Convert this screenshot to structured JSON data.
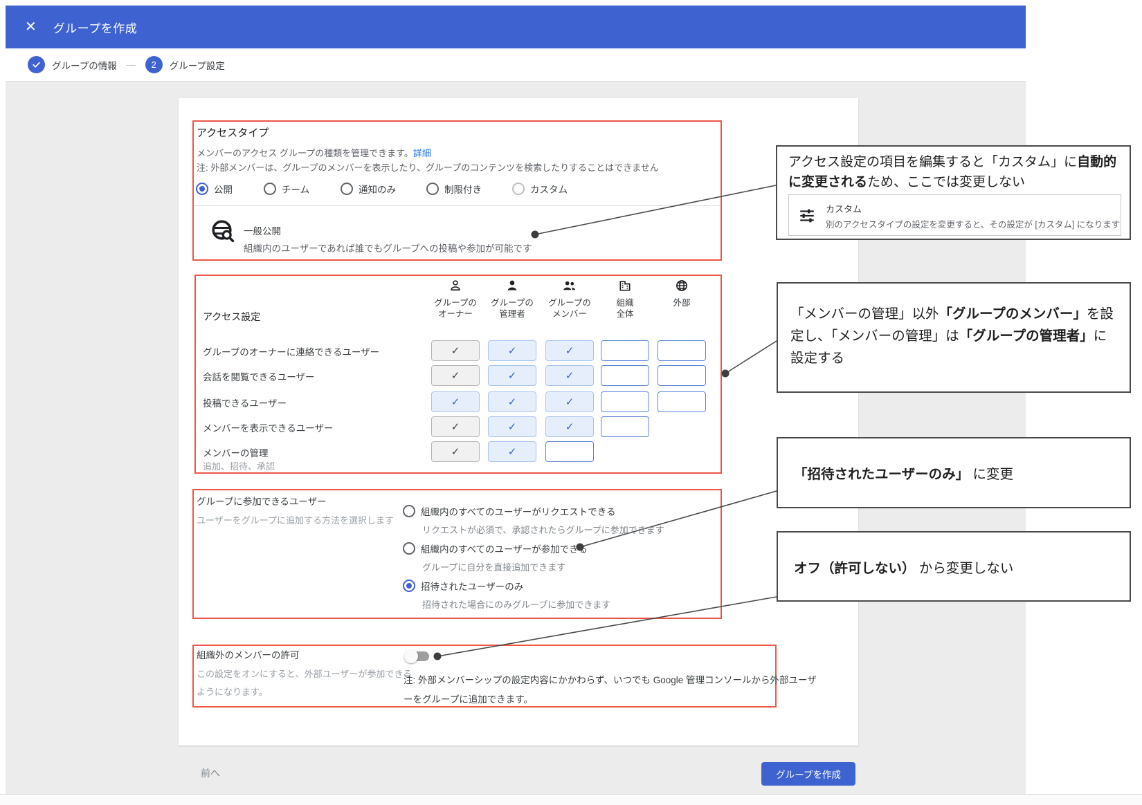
{
  "header": {
    "title": "グループを作成",
    "close_icon": "✕"
  },
  "stepper": {
    "separator": "—",
    "steps": [
      {
        "state": "done",
        "label": "グループの情報"
      },
      {
        "state": "active",
        "number": "2",
        "label": "グループ設定"
      }
    ]
  },
  "access_type": {
    "title": "アクセスタイプ",
    "description": "メンバーのアクセス グループの種類を管理できます。",
    "details_link": "詳細",
    "note": "注: 外部メンバーは、グループのメンバーを表示したり、グループのコンテンツを検索したりすることはできません",
    "options": [
      {
        "label": "公開",
        "selected": true,
        "dimmed": false
      },
      {
        "label": "チーム",
        "selected": false,
        "dimmed": false
      },
      {
        "label": "通知のみ",
        "selected": false,
        "dimmed": false
      },
      {
        "label": "制限付き",
        "selected": false,
        "dimmed": false
      },
      {
        "label": "カスタム",
        "selected": false,
        "dimmed": true
      }
    ],
    "selected_summary": {
      "icon": "public-search-icon",
      "title": "一般公開",
      "description": "組織内のユーザーであれば誰でもグループへの投稿や参加が可能です"
    }
  },
  "access_settings": {
    "title": "アクセス設定",
    "columns": [
      {
        "icon": "person-outline-icon",
        "label": "グループの\nオーナー"
      },
      {
        "icon": "person-filled-icon",
        "label": "グループの\n管理者"
      },
      {
        "icon": "people-icon",
        "label": "グループの\nメンバー"
      },
      {
        "icon": "building-icon",
        "label": "組織\n全体"
      },
      {
        "icon": "globe-icon",
        "label": "外部"
      }
    ],
    "rows": [
      {
        "label": "グループのオーナーに連絡できるユーザー",
        "sublabel": "",
        "cells": [
          "check-dark",
          "check-blue",
          "check-blue",
          "empty",
          "empty"
        ]
      },
      {
        "label": "会話を閲覧できるユーザー",
        "sublabel": "",
        "cells": [
          "check-dark",
          "check-blue",
          "check-blue",
          "empty",
          "empty"
        ]
      },
      {
        "label": "投稿できるユーザー",
        "sublabel": "",
        "cells": [
          "check-blue",
          "check-blue",
          "check-blue",
          "empty",
          "empty"
        ]
      },
      {
        "label": "メンバーを表示できるユーザー",
        "sublabel": "",
        "cells": [
          "check-dark",
          "check-blue",
          "check-blue",
          "empty",
          null
        ]
      },
      {
        "label": "メンバーの管理",
        "sublabel": "追加、招待、承認",
        "cells": [
          "check-dark",
          "check-blue",
          "empty",
          null,
          null
        ]
      }
    ],
    "check_glyph": "✓"
  },
  "join_group": {
    "title": "グループに参加できるユーザー",
    "subtitle": "ユーザーをグループに追加する方法を選択します",
    "options": [
      {
        "label": "組織内のすべてのユーザーがリクエストできる",
        "sub": "リクエストが必須で、承認されたらグループに参加できます",
        "selected": false
      },
      {
        "label": "組織内のすべてのユーザーが参加できる",
        "sub": "グループに自分を直接追加できます",
        "selected": false
      },
      {
        "label": "招待されたユーザーのみ",
        "sub": "招待された場合にのみグループに参加できます",
        "selected": true
      }
    ]
  },
  "external_members": {
    "title": "組織外のメンバーの許可",
    "description_line1": "この設定をオンにすると、外部ユーザーが参加できる",
    "description_line2": "ようになります。",
    "toggle_state": "off",
    "note_line1": "注: 外部メンバーシップの設定内容にかかわらず、いつでも Google 管理コンソールから外部ユーザ",
    "note_line2": "ーをグループに追加できます。"
  },
  "footer": {
    "back_label": "前へ",
    "create_label": "グループを作成"
  },
  "annotations": {
    "box1": {
      "segments": [
        {
          "text": "アクセス設定の項目を編集すると「カスタム」に",
          "bold": false
        },
        {
          "text": "自動的に変更される",
          "bold": true
        },
        {
          "text": "ため、ここでは変更しない",
          "bold": false
        }
      ],
      "custom_card": {
        "icon": "tune-icon",
        "title": "カスタム",
        "description": "別のアクセスタイプの設定を変更すると、その設定が [カスタム] になります"
      }
    },
    "box2": {
      "segments": [
        {
          "text": "「メンバーの管理」以外",
          "bold": false
        },
        {
          "text": "「グループのメンバー」",
          "bold": true
        },
        {
          "text": "を設定し、「メンバーの管理」は",
          "bold": false
        },
        {
          "text": "「グループの管理者」",
          "bold": true
        },
        {
          "text": "に設定する",
          "bold": false
        }
      ]
    },
    "box3": {
      "segments": [
        {
          "text": "「招待されたユーザーのみ」",
          "bold": true
        },
        {
          "text": " に変更",
          "bold": false
        }
      ]
    },
    "box4": {
      "segments": [
        {
          "text": "オフ（許可しない）",
          "bold": true
        },
        {
          "text": " から変更しない",
          "bold": false
        }
      ]
    }
  },
  "colors": {
    "primary_blue": "#3e63d1",
    "annotation_red": "#ee5649",
    "link_blue": "#1a73e8"
  }
}
